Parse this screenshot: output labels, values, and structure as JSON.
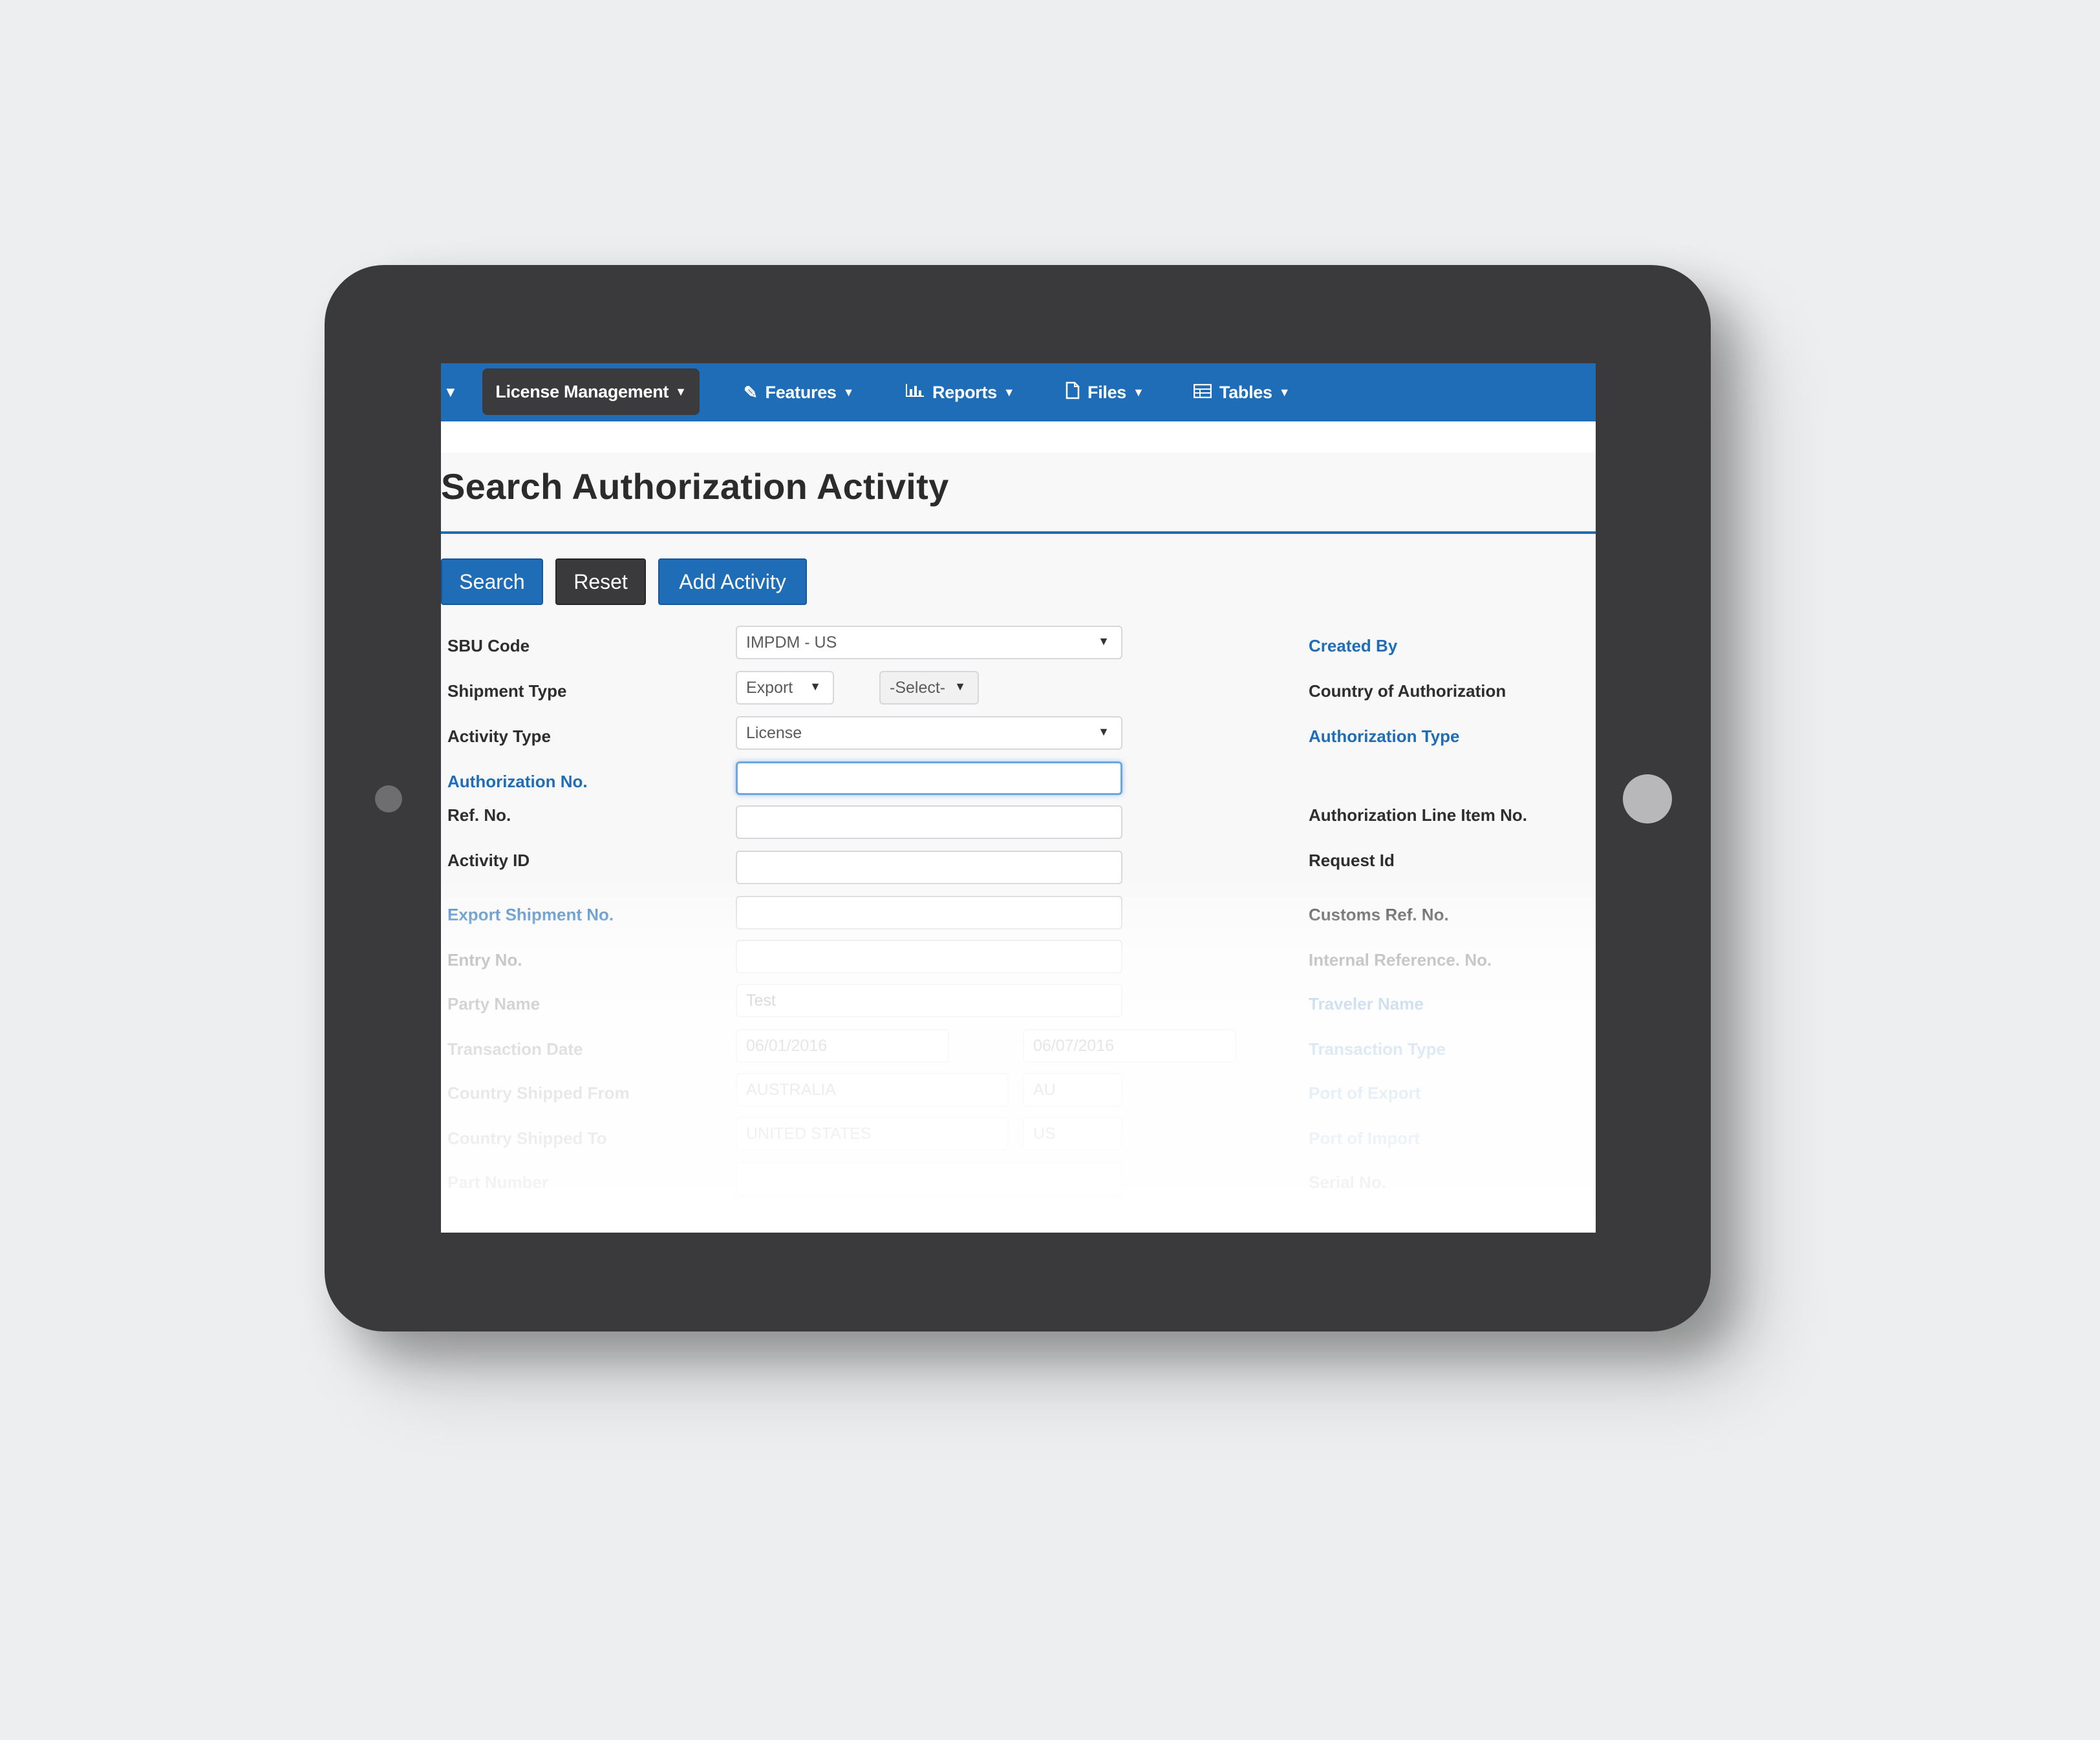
{
  "nav": {
    "active": "License Management",
    "items": [
      {
        "label": "Features",
        "icon": "pencil-icon"
      },
      {
        "label": "Reports",
        "icon": "bar-chart-icon"
      },
      {
        "label": "Files",
        "icon": "file-icon"
      },
      {
        "label": "Tables",
        "icon": "table-icon"
      }
    ]
  },
  "page": {
    "title": "Search Authorization Activity"
  },
  "buttons": {
    "search": "Search",
    "reset": "Reset",
    "add": "Add Activity"
  },
  "form": {
    "left_labels": [
      "SBU Code",
      "Shipment Type",
      "Activity Type",
      "Authorization No.",
      "Ref. No.",
      "Activity ID",
      "Export Shipment No.",
      "Entry No.",
      "Party Name",
      "Transaction Date",
      "Country Shipped From",
      "Country Shipped To",
      "Part Number"
    ],
    "right_labels": [
      "Created By",
      "Country of Authorization",
      "Authorization Type",
      "Authorization Line Item No.",
      "Request Id",
      "Customs Ref. No.",
      "Internal Reference. No.",
      "Traveler Name",
      "Transaction Type",
      "Port of Export",
      "Port of Import",
      "Serial No."
    ],
    "sbu_code": "IMPDM - US",
    "shipment_type": "Export",
    "shipment_sub": "-Select-",
    "activity_type": "License",
    "party_name": "Test",
    "date_from": "06/01/2016",
    "date_to": "06/07/2016",
    "country_from": "AUSTRALIA",
    "country_from_code": "AU",
    "country_to": "UNITED STATES",
    "country_to_code": "US"
  },
  "colors": {
    "brand": "#1f6db7",
    "dark": "#3a3a3c",
    "link": "#1f6db7"
  }
}
